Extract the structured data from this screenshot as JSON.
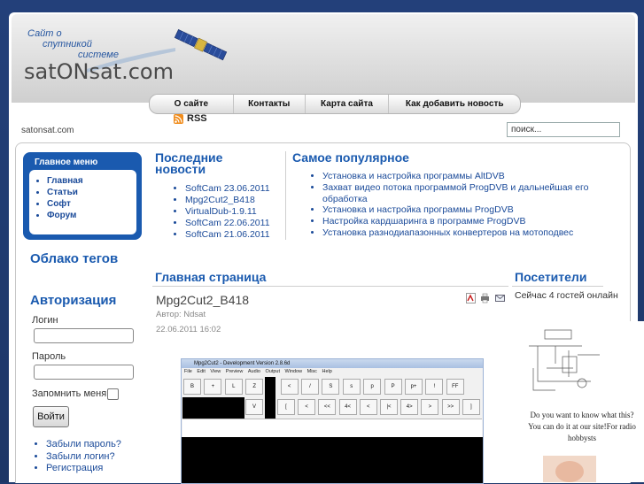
{
  "header": {
    "slogan_line1": "Сайт о",
    "slogan_line2": "спутникой",
    "slogan_line3": "системе",
    "logo": "satONsat.com",
    "site_url": "satonsat.com"
  },
  "topnav": [
    "О сайте",
    "Контакты",
    "Карта сайта",
    "Как добавить новость"
  ],
  "rss_label": "RSS",
  "search": {
    "value": "поиск..."
  },
  "main_menu": {
    "title": "Главное меню",
    "items": [
      "Главная",
      "Статьи",
      "Софт",
      "Форум"
    ]
  },
  "tag_cloud_title": "Облако тегов",
  "auth": {
    "title": "Авторизация",
    "login_label": "Логин",
    "password_label": "Пароль",
    "remember_label": "Запомнить меня",
    "submit_label": "Войти",
    "links": [
      "Забыли пароль?",
      "Забыли логин?",
      "Регистрация"
    ]
  },
  "latest_news": {
    "title_line1": "Последние",
    "title_line2": "новости",
    "items": [
      "SoftCam 23.06.2011",
      "Mpg2Cut2_B418",
      "VirtualDub-1.9.11",
      "SoftCam 22.06.2011",
      "SoftCam 21.06.2011"
    ]
  },
  "popular": {
    "title": "Самое популярное",
    "items": [
      "Установка и настройка программы AltDVB",
      "Захват видео потока программой ProgDVB и дальнейшая его",
      "обработка",
      "Установка и настройка программы ProgDVB",
      "Настройка кардшаринга в программе ProgDVB",
      "Установка разнодиапазонных конвертеров на мотоподвес"
    ]
  },
  "main_page_title": "Главная страница",
  "article": {
    "title": "Mpg2Cut2_B418",
    "author": "Автор: Ndsat",
    "date": "22.06.2011 16:02"
  },
  "visitors": {
    "title": "Посетители",
    "text": "Сейчас 4 гостей онлайн"
  },
  "ad": {
    "line1": "Do you want to know what this?",
    "line2": "You can do it at our site!For radio",
    "line3": "hobbysts"
  },
  "screenshot": {
    "window_title": "Mpg2Cut2 - Development Version 2.8.6d",
    "menu": [
      "File",
      "Edit",
      "View",
      "Preview",
      "Audio",
      "Output",
      "Window",
      "Misc",
      "Help"
    ],
    "row1": [
      "B",
      "+",
      "L",
      "Z",
      "<",
      "/",
      "S",
      "s",
      "p",
      "P",
      "p+",
      "!",
      "FF",
      "*"
    ],
    "row2": [
      "V",
      "[",
      "<",
      "<<",
      "4<",
      "<",
      "|<",
      "4>",
      ">",
      ">>",
      "]"
    ]
  }
}
